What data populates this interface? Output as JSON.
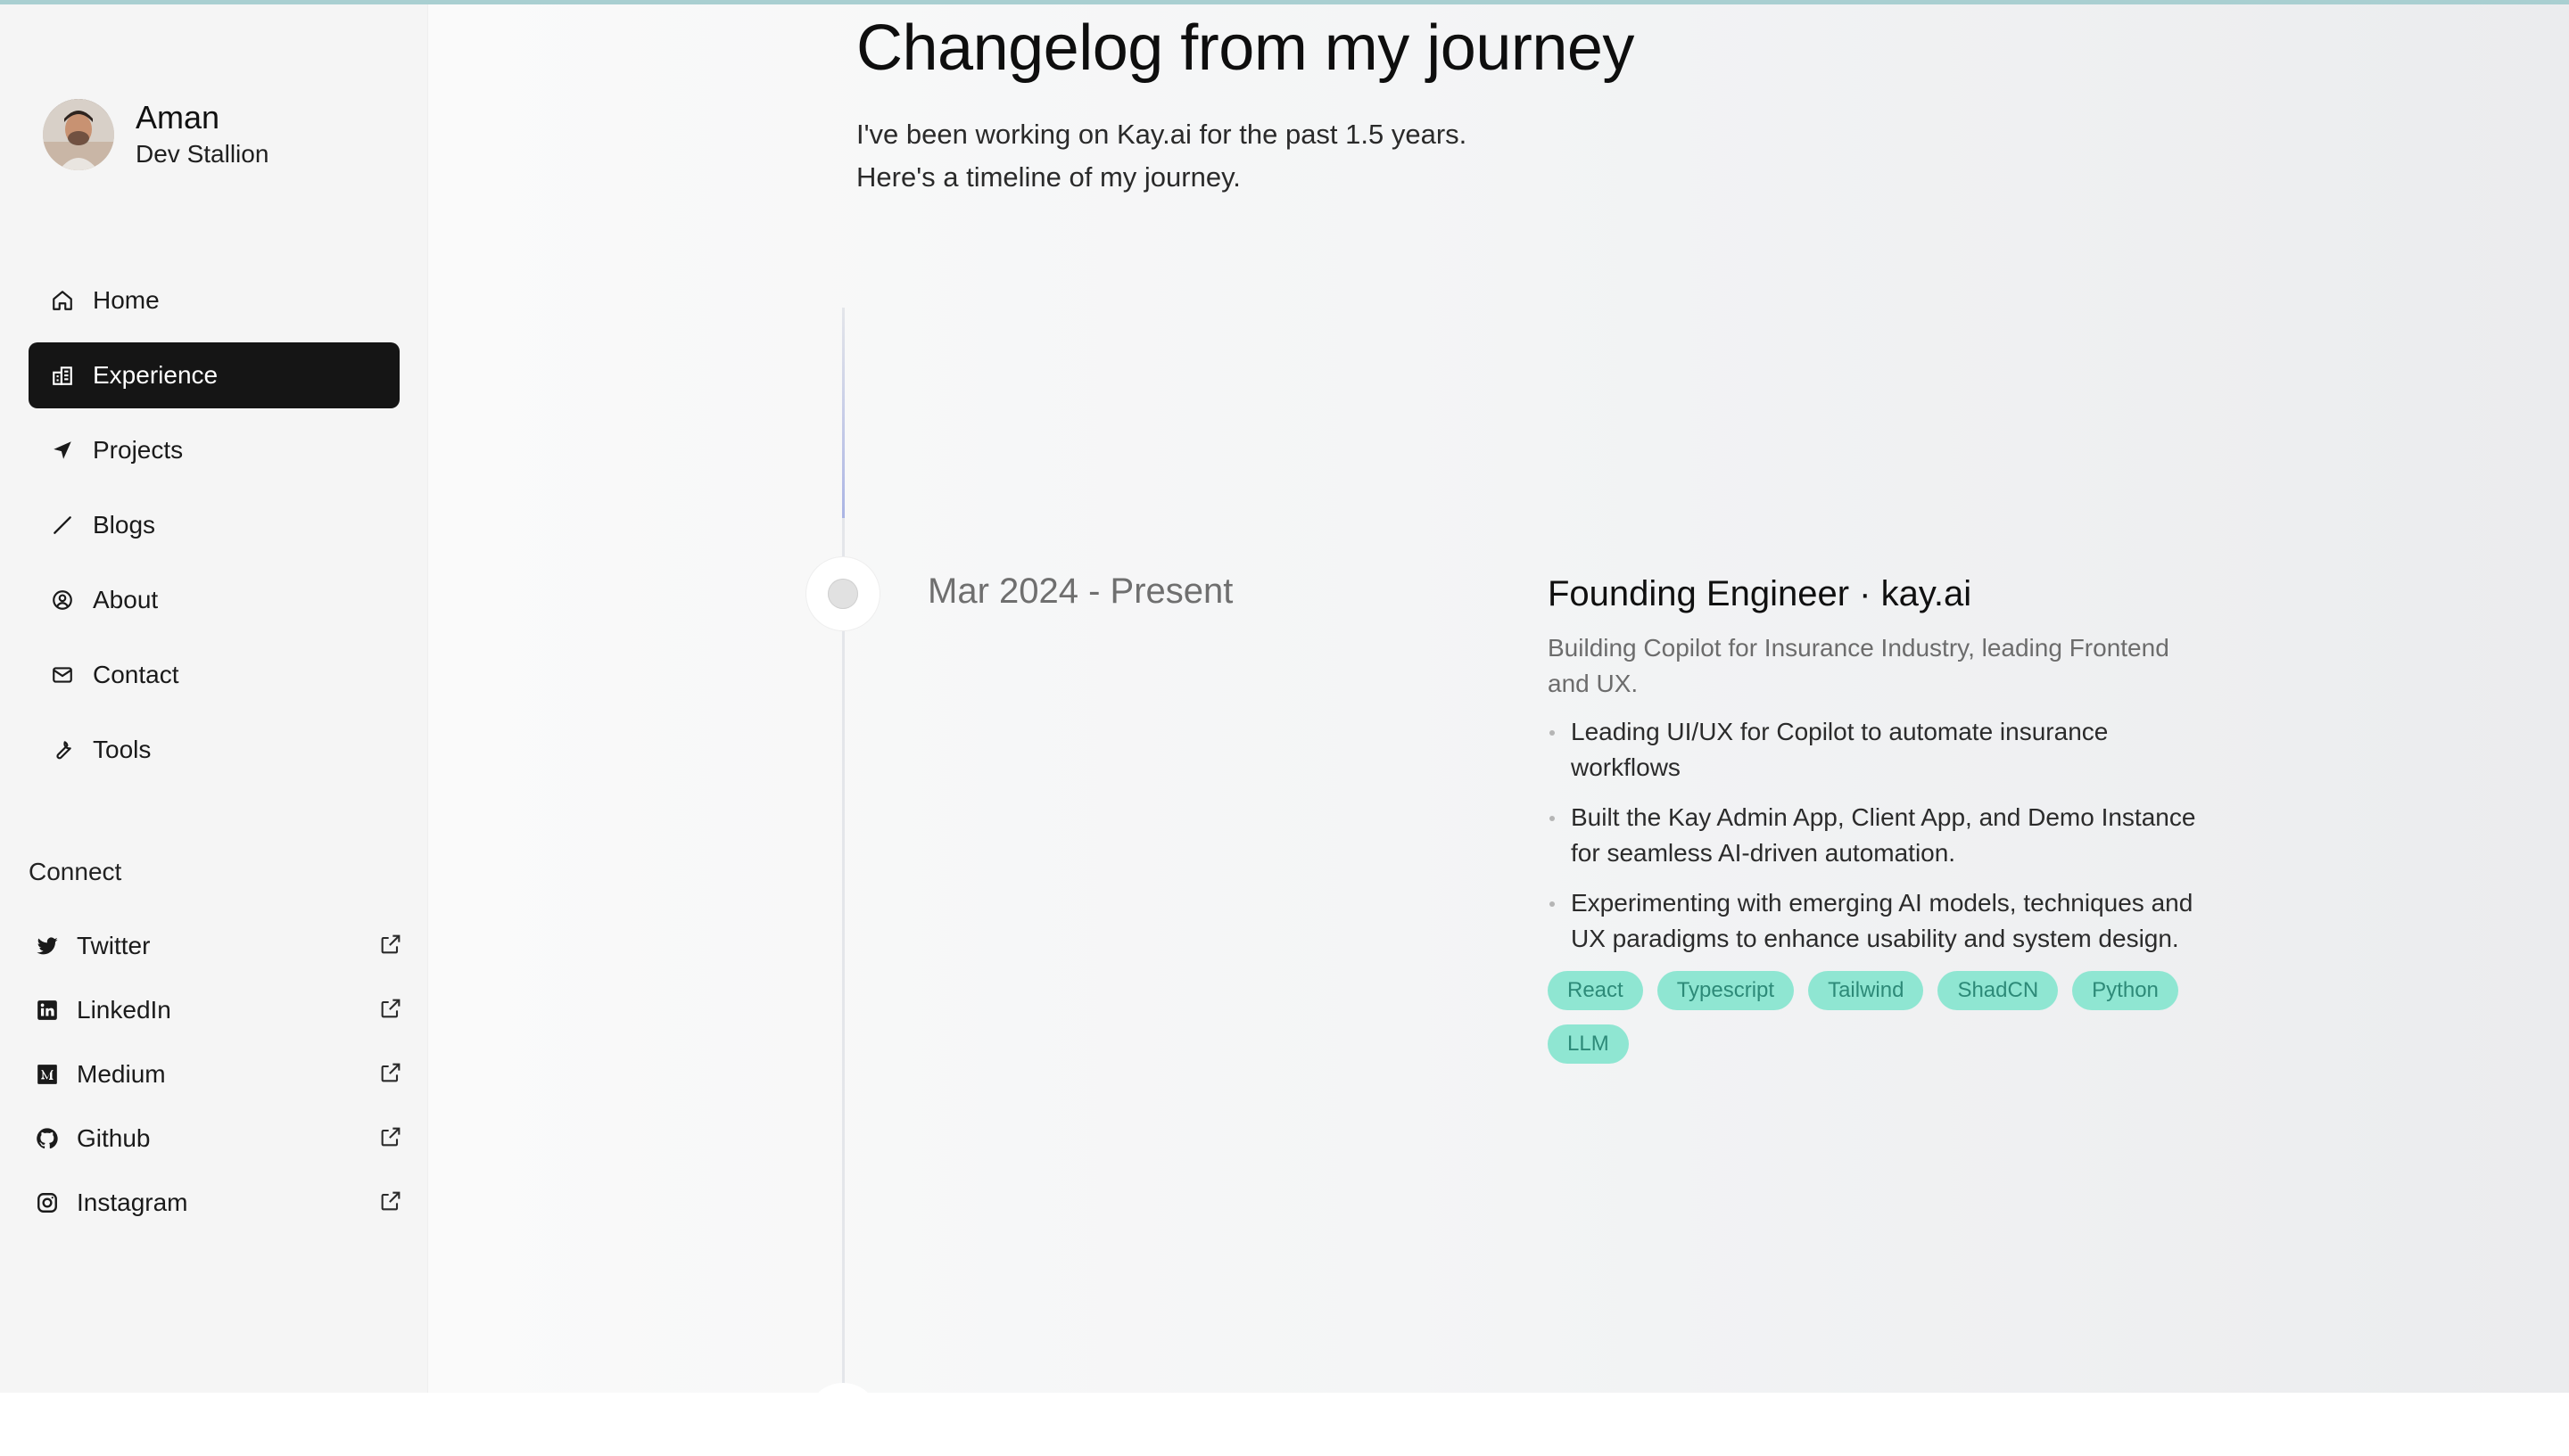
{
  "profile": {
    "name": "Aman",
    "subtitle": "Dev Stallion"
  },
  "nav": [
    {
      "label": "Home",
      "icon": "home-icon",
      "active": false
    },
    {
      "label": "Experience",
      "icon": "building-icon",
      "active": true
    },
    {
      "label": "Projects",
      "icon": "send-icon",
      "active": false
    },
    {
      "label": "Blogs",
      "icon": "pencil-icon",
      "active": false
    },
    {
      "label": "About",
      "icon": "user-circle-icon",
      "active": false
    },
    {
      "label": "Contact",
      "icon": "mail-icon",
      "active": false
    },
    {
      "label": "Tools",
      "icon": "wrench-icon",
      "active": false
    }
  ],
  "connect": {
    "title": "Connect",
    "items": [
      {
        "label": "Twitter",
        "icon": "twitter-icon"
      },
      {
        "label": "LinkedIn",
        "icon": "linkedin-icon"
      },
      {
        "label": "Medium",
        "icon": "medium-icon"
      },
      {
        "label": "Github",
        "icon": "github-icon"
      },
      {
        "label": "Instagram",
        "icon": "instagram-icon"
      }
    ]
  },
  "main": {
    "title": "Changelog from my journey",
    "intro_line1": "I've been working on Kay.ai for the past 1.5 years.",
    "intro_line2": "Here's a timeline of my journey."
  },
  "timeline": [
    {
      "period": "Mar 2024 - Present",
      "title": "Founding Engineer · kay.ai",
      "description": "Building Copilot for Insurance Industry, leading Frontend and UX.",
      "bullets": [
        "Leading UI/UX for Copilot to automate insurance workflows",
        "Built the Kay Admin App, Client App, and Demo Instance for seamless AI-driven automation.",
        "Experimenting with emerging AI models, techniques and UX paradigms to enhance usability and system design."
      ],
      "tags": [
        "React",
        "Typescript",
        "Tailwind",
        "ShadCN",
        "Python",
        "LLM"
      ]
    }
  ],
  "colors": {
    "active_nav_bg": "#151515",
    "tag_bg": "#8fe6d2",
    "tag_text": "#2d8a78",
    "top_accent": "#a9cfd1"
  }
}
